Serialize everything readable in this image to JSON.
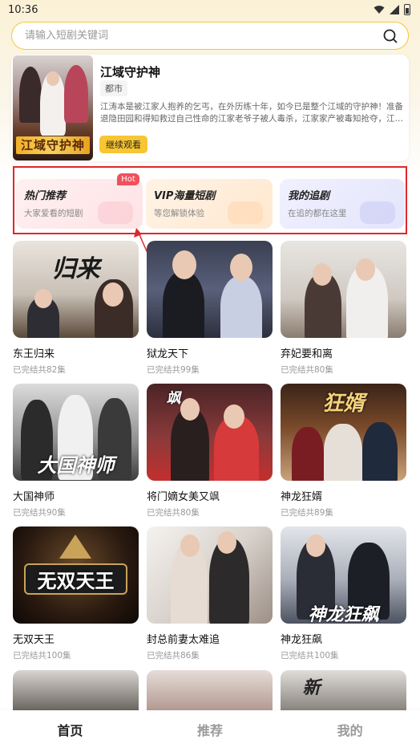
{
  "status_bar": {
    "time": "10:36"
  },
  "search": {
    "placeholder": "请输入短剧关键词"
  },
  "featured": {
    "title": "江域守护神",
    "tag": "都市",
    "description": "江涛本是被江家人抱养的乞丐，在外历练十年，如今已是整个江域的守护神！准备退隐田园和得知救过自己性命的江家老爷子被人毒杀，江家家产被毒知抢夺，江…",
    "button": "继续观看",
    "poster_text": "江域守护神"
  },
  "categories": [
    {
      "title": "热门推荐",
      "subtitle": "大家爱看的短剧",
      "badge": "Hot"
    },
    {
      "title": "VIP海量短剧",
      "subtitle": "等您解锁体验"
    },
    {
      "title": "我的追剧",
      "subtitle": "在追的都在这里"
    }
  ],
  "dramas": [
    {
      "title": "东王归来",
      "episodes": "已完结共82集",
      "poster_text": "归来"
    },
    {
      "title": "狱龙天下",
      "episodes": "已完结共99集",
      "poster_text": ""
    },
    {
      "title": "弃妃要和离",
      "episodes": "已完结共80集",
      "poster_text": ""
    },
    {
      "title": "大国神师",
      "episodes": "已完结共90集",
      "poster_text": "大国神师"
    },
    {
      "title": "将门嫡女美又飒",
      "episodes": "已完结共80集",
      "poster_text": "飒"
    },
    {
      "title": "神龙狂婿",
      "episodes": "已完结共89集",
      "poster_text": "狂婿"
    },
    {
      "title": "无双天王",
      "episodes": "已完结共100集",
      "poster_text": "无双天王"
    },
    {
      "title": "封总前妻太难追",
      "episodes": "已完结共86集",
      "poster_text": ""
    },
    {
      "title": "神龙狂飙",
      "episodes": "已完结共100集",
      "poster_text": "神龙狂飙"
    }
  ],
  "partial_row_poster_text": "新",
  "nav": {
    "home": "首页",
    "recommend": "推荐",
    "mine": "我的",
    "active": "首页"
  },
  "colors": {
    "accent": "#f7c632",
    "highlight": "#e0272b",
    "hot": "#f0505b"
  }
}
